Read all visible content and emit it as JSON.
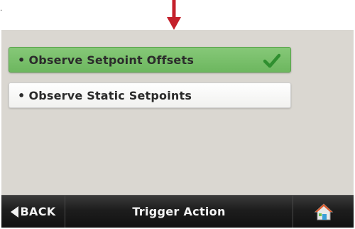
{
  "corner_mark": ".",
  "options": [
    {
      "label": "Observe Setpoint Offsets",
      "bullet": "•",
      "selected": true,
      "icon": "check-icon"
    },
    {
      "label": "Observe Static Setpoints",
      "bullet": "•",
      "selected": false
    }
  ],
  "footer": {
    "back_label": "BACK",
    "title": "Trigger Action",
    "home_icon": "home-icon"
  },
  "colors": {
    "annotation_arrow": "#c4202b",
    "selected_option": "#7cc16e",
    "screen_background": "#dad7d1",
    "footer_bar": "#1d1d1d"
  }
}
